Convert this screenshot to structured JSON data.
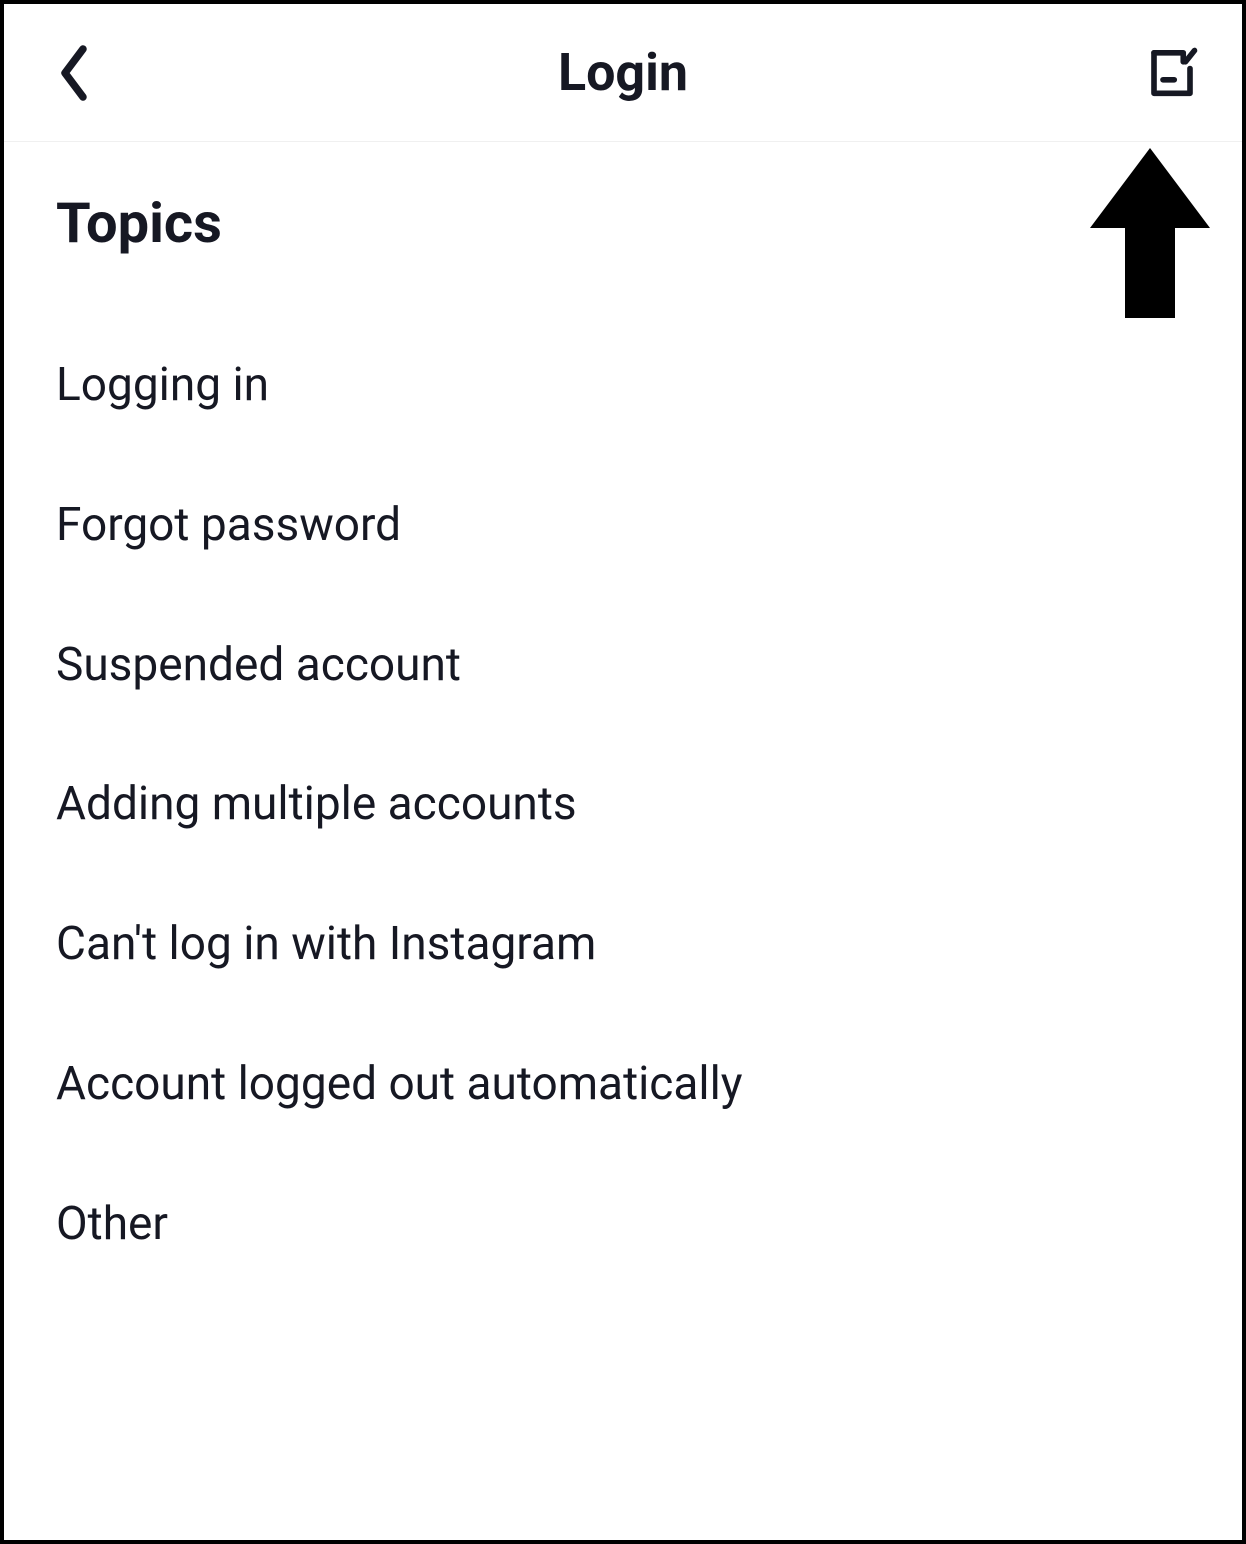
{
  "header": {
    "title": "Login"
  },
  "section": {
    "title": "Topics"
  },
  "topics": [
    {
      "label": "Logging in"
    },
    {
      "label": "Forgot password"
    },
    {
      "label": "Suspended account"
    },
    {
      "label": "Adding multiple accounts"
    },
    {
      "label": "Can't log in with Instagram"
    },
    {
      "label": "Account logged out automatically"
    },
    {
      "label": "Other"
    }
  ]
}
